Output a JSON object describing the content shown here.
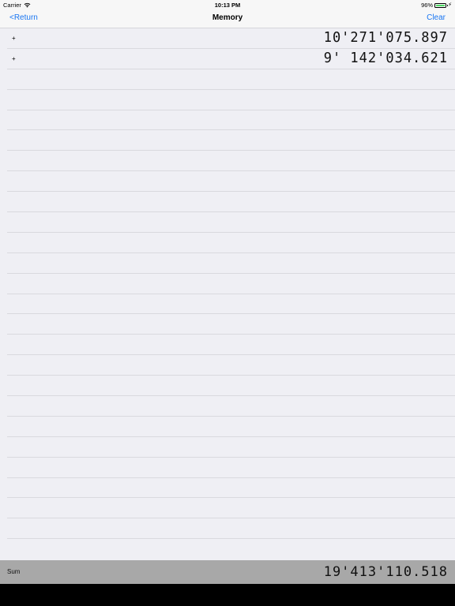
{
  "status_bar": {
    "carrier": "Carrier",
    "time": "10:13 PM",
    "battery_percent": "96%",
    "battery_level": 0.96,
    "icons": [
      "wifi-icon",
      "battery-icon",
      "charging-icon"
    ]
  },
  "nav": {
    "back_label": "<Return",
    "title": "Memory",
    "clear_label": "Clear",
    "accent_color": "#1a76f2"
  },
  "memory": {
    "items": [
      {
        "op": "+",
        "value": "10'271'075.897"
      },
      {
        "op": "+",
        "value": "9' 142'034.621"
      }
    ],
    "empty_rows": 23
  },
  "sum": {
    "label": "Sum",
    "value": "19'413'110.518"
  }
}
